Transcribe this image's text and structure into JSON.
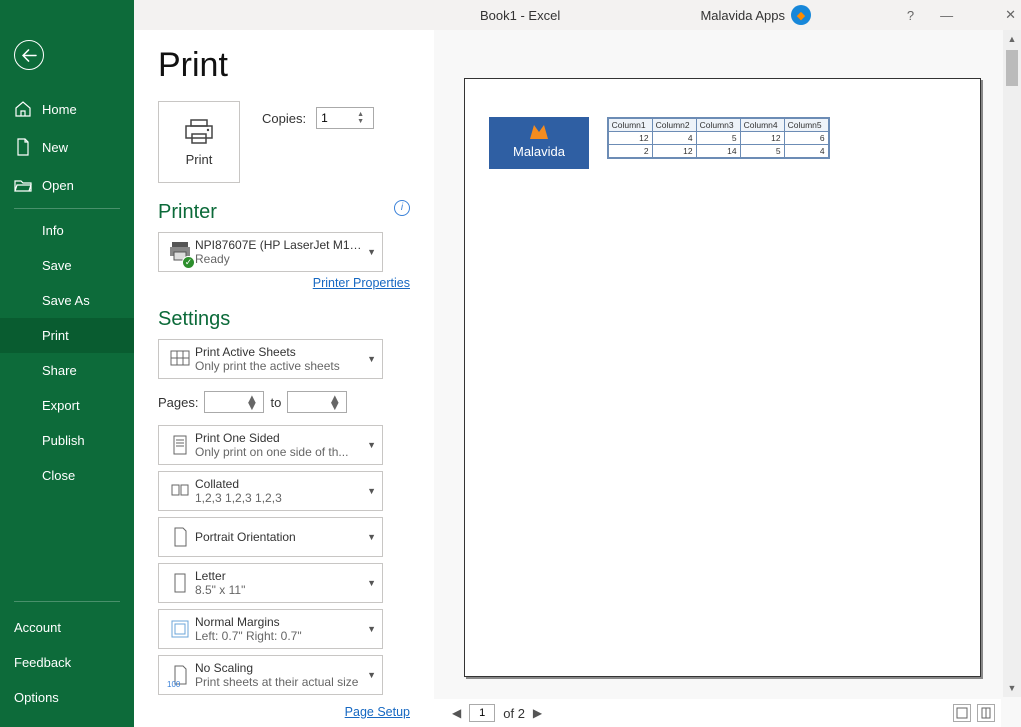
{
  "titlebar": {
    "title": "Book1  -  Excel",
    "app_label": "Malavida Apps",
    "help": "?"
  },
  "sidebar": {
    "top": [
      {
        "label": "Home"
      },
      {
        "label": "New"
      },
      {
        "label": "Open"
      }
    ],
    "sub": [
      {
        "label": "Info"
      },
      {
        "label": "Save"
      },
      {
        "label": "Save As"
      },
      {
        "label": "Print"
      },
      {
        "label": "Share"
      },
      {
        "label": "Export"
      },
      {
        "label": "Publish"
      },
      {
        "label": "Close"
      }
    ],
    "bottom": [
      {
        "label": "Account"
      },
      {
        "label": "Feedback"
      },
      {
        "label": "Options"
      }
    ]
  },
  "print": {
    "heading": "Print",
    "print_btn": "Print",
    "copies_label": "Copies:",
    "copies_value": "1",
    "printer_heading": "Printer",
    "printer_name": "NPI87607E (HP LaserJet M15...",
    "printer_status": "Ready",
    "printer_properties": "Printer Properties",
    "settings_heading": "Settings",
    "active_sheets": {
      "line1": "Print Active Sheets",
      "line2": "Only print the active sheets"
    },
    "pages_label": "Pages:",
    "pages_from": "",
    "pages_to_label": "to",
    "pages_to": "",
    "one_sided": {
      "line1": "Print One Sided",
      "line2": "Only print on one side of th..."
    },
    "collated": {
      "line1": "Collated",
      "line2": "1,2,3    1,2,3    1,2,3"
    },
    "orientation": {
      "line1": "Portrait Orientation"
    },
    "paper": {
      "line1": "Letter",
      "line2": "8.5\" x 11\""
    },
    "margins": {
      "line1": "Normal Margins",
      "line2": "Left:  0.7\"    Right:  0.7\""
    },
    "scaling": {
      "line1": "No Scaling",
      "line2": "Print sheets at their actual size",
      "badge": "100"
    },
    "page_setup": "Page Setup"
  },
  "preview": {
    "logo_text": "Malavida",
    "columns": [
      "Column1",
      "Column2",
      "Column3",
      "Column4",
      "Column5"
    ],
    "rows": [
      [
        "12",
        "4",
        "5",
        "12",
        "6"
      ],
      [
        "2",
        "12",
        "14",
        "5",
        "4"
      ]
    ],
    "pager_current": "1",
    "pager_total": "of 2"
  }
}
